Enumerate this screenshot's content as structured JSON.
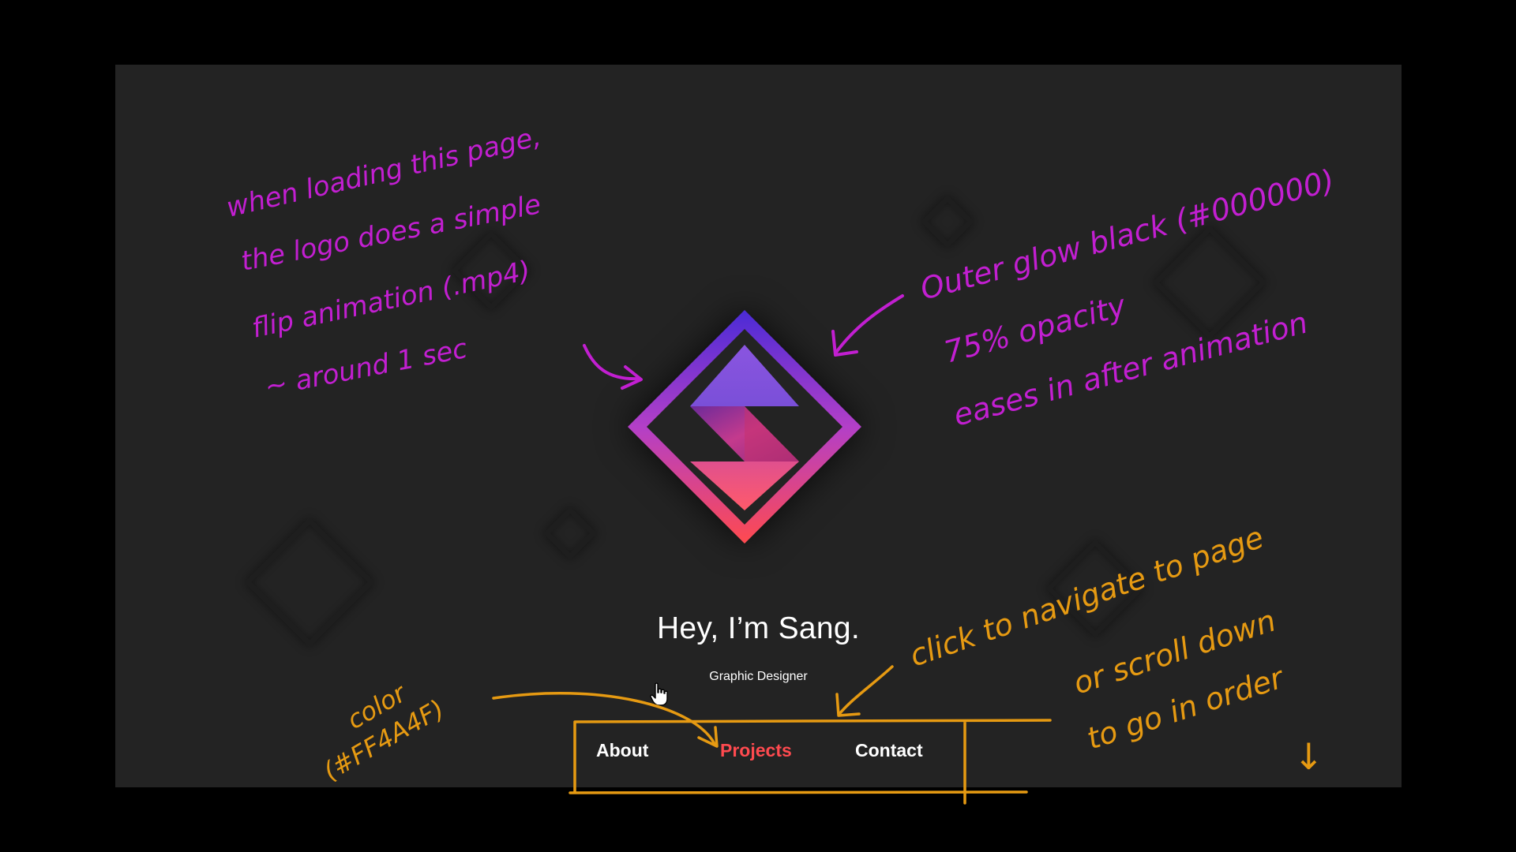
{
  "hero": {
    "title": "Hey, I’m Sang.",
    "subtitle": "Graphic Designer"
  },
  "nav": {
    "items": [
      {
        "label": "About",
        "active": false
      },
      {
        "label": "Projects",
        "active": true
      },
      {
        "label": "Contact",
        "active": false
      }
    ]
  },
  "logo": {
    "icon": "s-diamond-logo",
    "gradient_top": "#4B2BD6",
    "gradient_mid": "#B33FC8",
    "gradient_bottom": "#FF4A4F"
  },
  "annotations": {
    "logo_note": [
      "when loading this page,",
      "the logo does a simple",
      "flip animation (.mp4)",
      "~ around 1 sec"
    ],
    "glow_note": [
      "Outer glow black (#000000)",
      "75% opacity",
      "eases in after animation"
    ],
    "color_note": [
      "color",
      "(#FF4A4F)"
    ],
    "nav_note": [
      "click to navigate to page",
      "or scroll down",
      "to go in order",
      "↓"
    ]
  },
  "colors": {
    "page_bg": "#000000",
    "window_bg": "#232323",
    "active_nav": "#FF4A4F",
    "annotation_purple": "#C21FD1",
    "annotation_orange": "#E69A12"
  }
}
